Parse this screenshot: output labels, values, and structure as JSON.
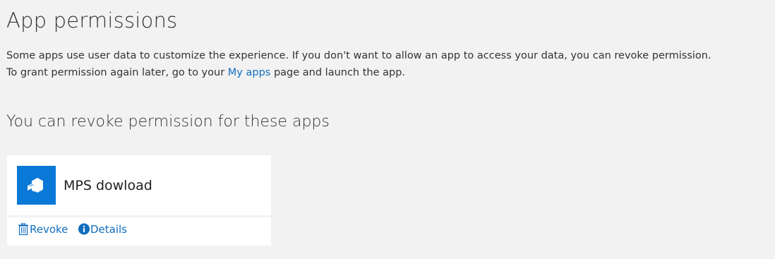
{
  "header": {
    "title": "App permissions"
  },
  "description": {
    "line1": "Some apps use user data to customize the experience. If you don't want to allow an app to access your data, you can revoke permission.",
    "line2_before": "To grant permission again later, go to your ",
    "my_apps_link": "My apps",
    "line2_after": " page and launch the app."
  },
  "section": {
    "title": "You can revoke permission for these apps"
  },
  "apps": [
    {
      "name": "MPS dowload",
      "icon": "app-tile-icon",
      "icon_color": "#0a78d7",
      "actions": {
        "revoke_label": "Revoke",
        "revoke_icon": "trash-icon",
        "details_label": "Details",
        "details_icon": "info-icon"
      }
    }
  ],
  "colors": {
    "background": "#f2f2f2",
    "link": "#106ebe",
    "text": "#333333",
    "card": "#ffffff"
  }
}
